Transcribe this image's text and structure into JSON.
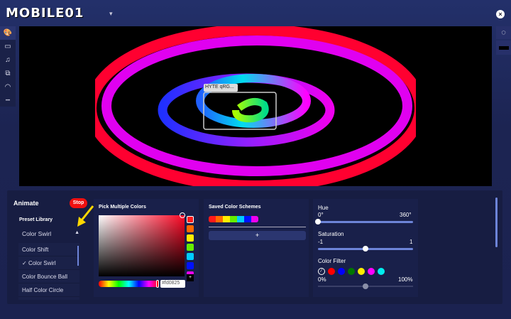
{
  "header": {
    "logo": "MOBILE01",
    "menu_caret": "▾",
    "close": "×"
  },
  "sidebar": {
    "items": [
      {
        "icon": "palette-icon",
        "glyph": "🎨",
        "active": true
      },
      {
        "icon": "monitor-icon",
        "glyph": "▭"
      },
      {
        "icon": "music-icon",
        "glyph": "♫"
      },
      {
        "icon": "gallery-icon",
        "glyph": "⧉"
      },
      {
        "icon": "gauge-icon",
        "glyph": "◠"
      },
      {
        "icon": "more-icon",
        "glyph": "•••"
      }
    ]
  },
  "preview": {
    "device_label": "HYTE qRG..."
  },
  "animate": {
    "title": "Animate",
    "stop_label": "Stop",
    "preset_label": "Preset Library",
    "selected": "Color Swirl",
    "options": [
      {
        "label": "Color Shift",
        "checked": false
      },
      {
        "label": "Color Swirl",
        "checked": true
      },
      {
        "label": "Color Bounce Ball",
        "checked": false
      },
      {
        "label": "Half Color Circle",
        "checked": false
      }
    ]
  },
  "picker": {
    "title": "Pick Multiple Colors",
    "hex": "#fd0825",
    "swatches": [
      "#ff1a1a",
      "#ff6a00",
      "#ffee00",
      "#66ee00",
      "#00ccff",
      "#0011ff",
      "#ee00ee"
    ],
    "add": "+"
  },
  "schemes": {
    "title": "Saved Color Schemes",
    "scheme_colors": [
      "#ff1a1a",
      "#ff6a00",
      "#ffee00",
      "#66ee00",
      "#00ccff",
      "#0011ff",
      "#ee00ee"
    ],
    "add": "+"
  },
  "hue": {
    "label": "Hue",
    "min": "0°",
    "max": "360°",
    "value": 0
  },
  "saturation": {
    "label": "Saturation",
    "min": "-1",
    "max": "1",
    "value": 0
  },
  "filter": {
    "label": "Color Filter",
    "colors": [
      "#ff0000",
      "#0000ff",
      "#007700",
      "#ffee00",
      "#ff00ff",
      "#00eeee"
    ],
    "min": "0%",
    "max": "100%",
    "value": 50
  }
}
